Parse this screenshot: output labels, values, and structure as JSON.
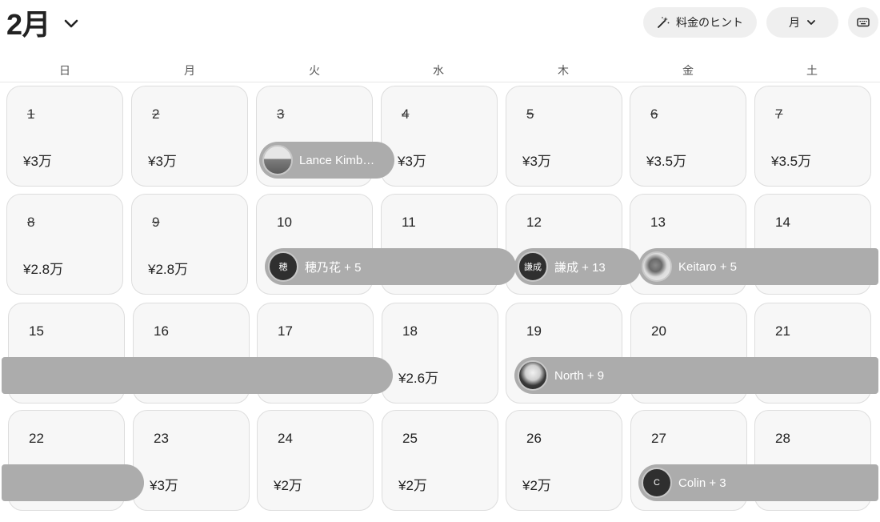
{
  "header": {
    "month_title": "2月",
    "price_tips_label": "料金のヒント",
    "view_select_label": "月"
  },
  "weekdays": [
    "日",
    "月",
    "火",
    "水",
    "木",
    "金",
    "土"
  ],
  "weeks": [
    [
      {
        "day": "1",
        "price": "¥3万",
        "past": true
      },
      {
        "day": "2",
        "price": "¥3万",
        "past": true
      },
      {
        "day": "3",
        "price": "",
        "past": true
      },
      {
        "day": "4",
        "price": "¥3万",
        "past": true
      },
      {
        "day": "5",
        "price": "¥3万",
        "past": true
      },
      {
        "day": "6",
        "price": "¥3.5万",
        "past": true
      },
      {
        "day": "7",
        "price": "¥3.5万",
        "past": true
      }
    ],
    [
      {
        "day": "8",
        "price": "¥2.8万",
        "past": true
      },
      {
        "day": "9",
        "price": "¥2.8万",
        "past": true
      },
      {
        "day": "10",
        "price": "",
        "past": false
      },
      {
        "day": "11",
        "price": "",
        "past": false
      },
      {
        "day": "12",
        "price": "",
        "past": false
      },
      {
        "day": "13",
        "price": "",
        "past": false
      },
      {
        "day": "14",
        "price": "",
        "past": false
      }
    ],
    [
      {
        "day": "15",
        "price": "",
        "past": false
      },
      {
        "day": "16",
        "price": "",
        "past": false
      },
      {
        "day": "17",
        "price": "",
        "past": false
      },
      {
        "day": "18",
        "price": "¥2.6万",
        "past": false
      },
      {
        "day": "19",
        "price": "",
        "past": false
      },
      {
        "day": "20",
        "price": "",
        "past": false
      },
      {
        "day": "21",
        "price": "",
        "past": false
      }
    ],
    [
      {
        "day": "22",
        "price": "",
        "past": false
      },
      {
        "day": "23",
        "price": "¥3万",
        "past": false
      },
      {
        "day": "24",
        "price": "¥2万",
        "past": false
      },
      {
        "day": "25",
        "price": "¥2万",
        "past": false
      },
      {
        "day": "26",
        "price": "¥2万",
        "past": false
      },
      {
        "day": "27",
        "price": "",
        "past": false
      },
      {
        "day": "28",
        "price": "",
        "past": false
      }
    ]
  ],
  "reservations": {
    "lance": {
      "guest": "Lance Kimb…",
      "avatar": "photo"
    },
    "hono": {
      "guest": "穂乃花 + 5",
      "initial": "穂"
    },
    "kensei": {
      "guest": "謙成 + 13",
      "initial": "謙成"
    },
    "keitaro": {
      "guest": "Keitaro + 5",
      "avatar": "photo"
    },
    "week3_start": {
      "guest": ""
    },
    "north": {
      "guest": "North + 9",
      "avatar": "photo"
    },
    "week4_start": {
      "guest": ""
    },
    "colin": {
      "guest": "Colin + 3",
      "initial": "C"
    }
  }
}
